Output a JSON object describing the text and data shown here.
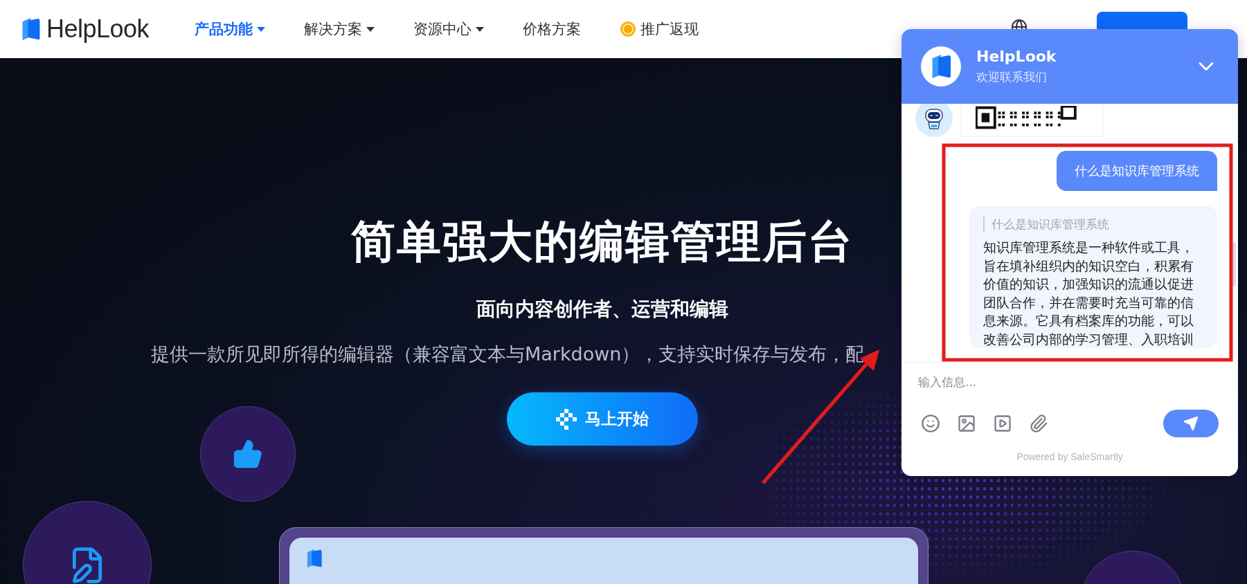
{
  "header": {
    "logo": "HelpLook",
    "nav": [
      {
        "label": "产品功能",
        "selected": true,
        "kind": "dropdown"
      },
      {
        "label": "解决方案",
        "selected": false,
        "kind": "dropdown"
      },
      {
        "label": "资源中心",
        "selected": false,
        "kind": "dropdown"
      },
      {
        "label": "价格方案",
        "selected": false,
        "kind": "link"
      },
      {
        "label": "推广返现",
        "selected": false,
        "kind": "promo"
      }
    ]
  },
  "hero": {
    "title": "简单强大的编辑管理后台",
    "subtitle": "面向内容创作者、运营和编辑",
    "description": "提供一款所见即所得的编辑器（兼容富文本与Markdown），支持实时保存与发布，配",
    "button": "马上开始"
  },
  "chat": {
    "title": "HelpLook",
    "subtitle": "欢迎联系我们",
    "messages": [
      {
        "kind": "image"
      },
      {
        "kind": "user",
        "text": "什么是知识库管理系统"
      },
      {
        "kind": "bot",
        "quote": "什么是知识库管理系统",
        "text": "知识库管理系统是一种软件或工具，旨在填补组织内的知识空白，积累有价值的知识，加强知识的流通以促进团队合作，并在需要时充当可靠的信息来源。它具有档案库的功能，可以改善公司内部的学习管理、入职培训"
      }
    ],
    "input": {
      "placeholder": "输入信息..."
    },
    "footer": "Powered by SaleSmartly"
  },
  "annotations": [
    {
      "kind": "frame"
    },
    {
      "kind": "arrow"
    }
  ]
}
